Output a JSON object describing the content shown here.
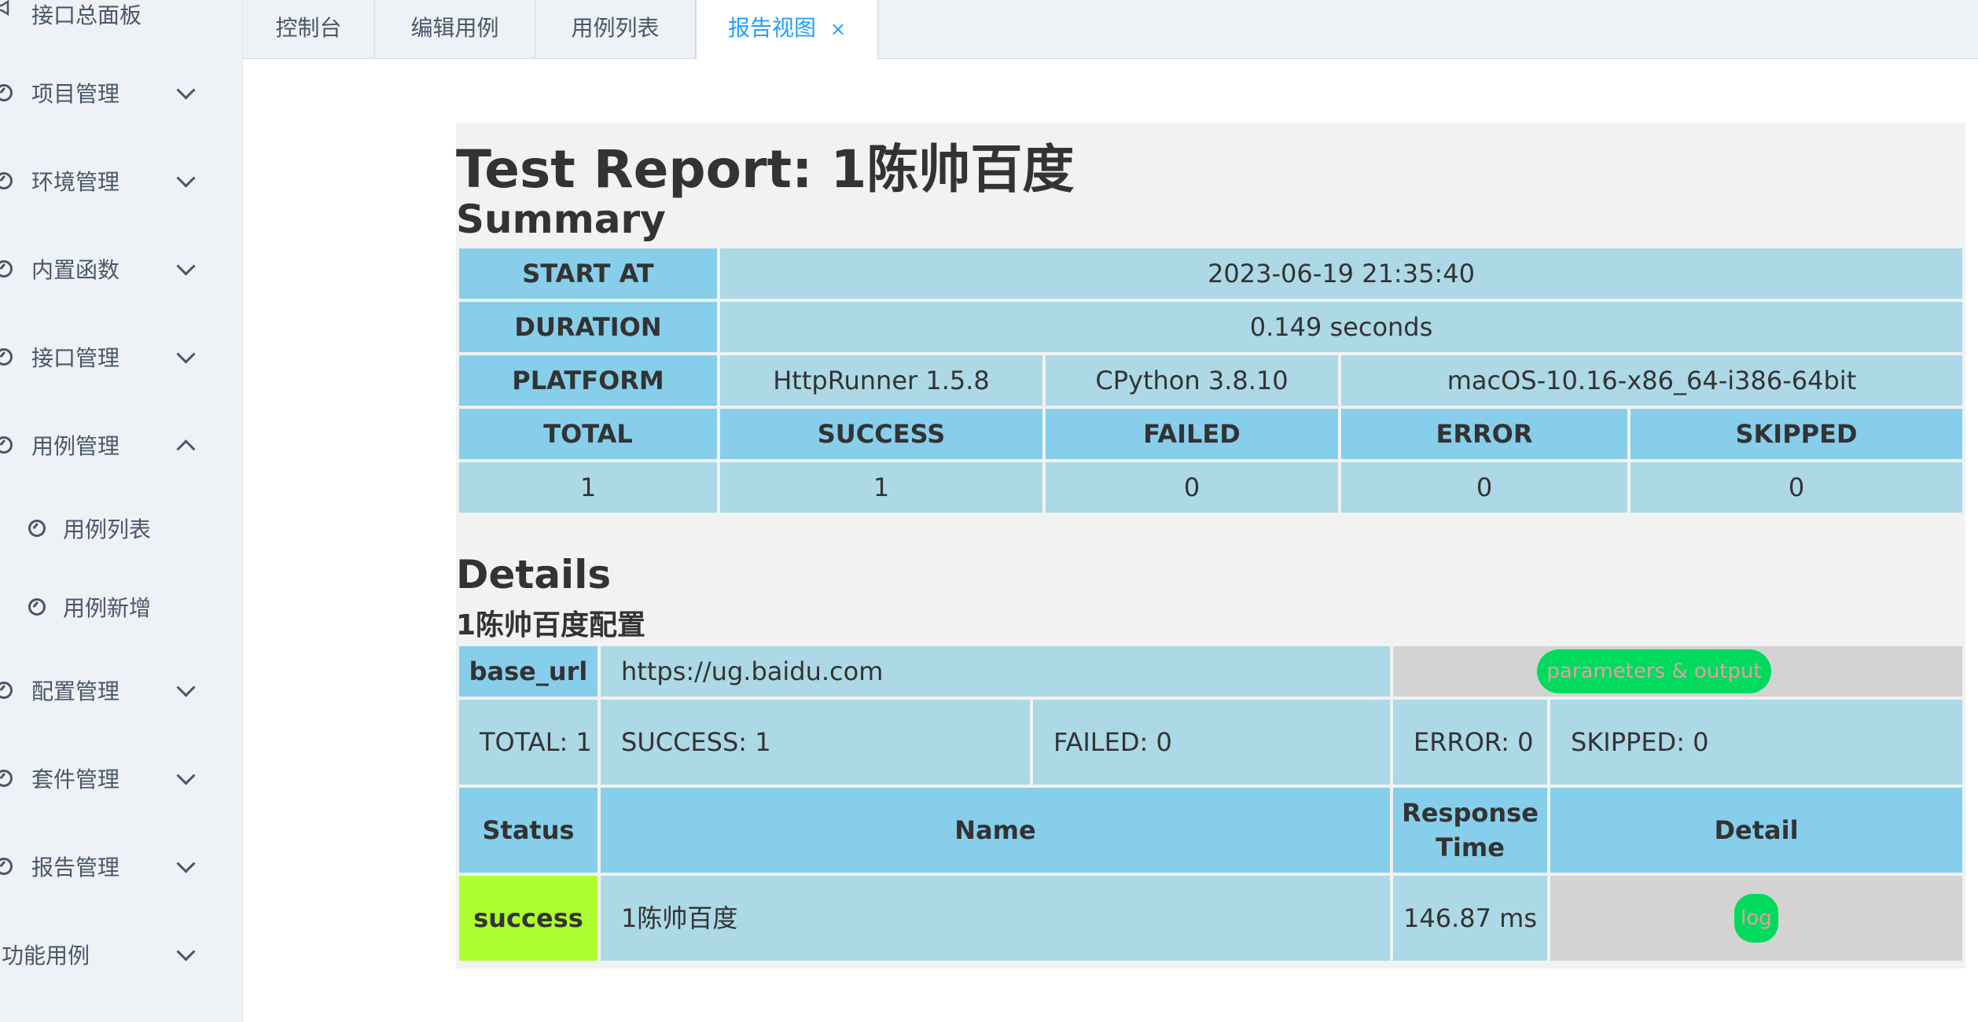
{
  "sidebar": {
    "top_item": "接口总面板",
    "items": [
      {
        "label": "项目管理"
      },
      {
        "label": "环境管理"
      },
      {
        "label": "内置函数"
      },
      {
        "label": "接口管理"
      },
      {
        "label": "用例管理"
      },
      {
        "label": "用例列表"
      },
      {
        "label": "用例新增"
      },
      {
        "label": "配置管理"
      },
      {
        "label": "套件管理"
      },
      {
        "label": "报告管理"
      },
      {
        "label": "功能用例"
      }
    ]
  },
  "tabs": [
    {
      "label": "控制台"
    },
    {
      "label": "编辑用例"
    },
    {
      "label": "用例列表"
    },
    {
      "label": "报告视图",
      "close": "×"
    }
  ],
  "report": {
    "title": "Test Report: 1陈帅百度",
    "summary_heading": "Summary",
    "summary": {
      "start_at_label": "START AT",
      "start_at_value": "2023-06-19 21:35:40",
      "duration_label": "DURATION",
      "duration_value": "0.149 seconds",
      "platform_label": "PLATFORM",
      "platform_runner": "HttpRunner 1.5.8",
      "platform_python": "CPython 3.8.10",
      "platform_os": "macOS-10.16-x86_64-i386-64bit",
      "headers": [
        "TOTAL",
        "SUCCESS",
        "FAILED",
        "ERROR",
        "SKIPPED"
      ],
      "values": [
        "1",
        "1",
        "0",
        "0",
        "0"
      ]
    },
    "details_heading": "Details",
    "config_name": "1陈帅百度配置",
    "details": {
      "base_url_label": "base_url",
      "base_url_value": "https://ug.baidu.com",
      "params_button": "parameters & output",
      "total": "TOTAL: 1",
      "success": "SUCCESS: 1",
      "failed": "FAILED: 0",
      "error": "ERROR: 0",
      "skipped": "SKIPPED: 0",
      "col_status": "Status",
      "col_name": "Name",
      "col_response": "Response Time",
      "col_detail": "Detail",
      "row_status": "success",
      "row_name": "1陈帅百度",
      "row_response": "146.87 ms",
      "row_log": "log"
    }
  },
  "colors": {
    "header_cell": "#87ceeb",
    "value_cell": "#add8e6",
    "success_cell": "#adff2f",
    "pill": "#00db5e",
    "active_tab": "#20a0ff"
  }
}
